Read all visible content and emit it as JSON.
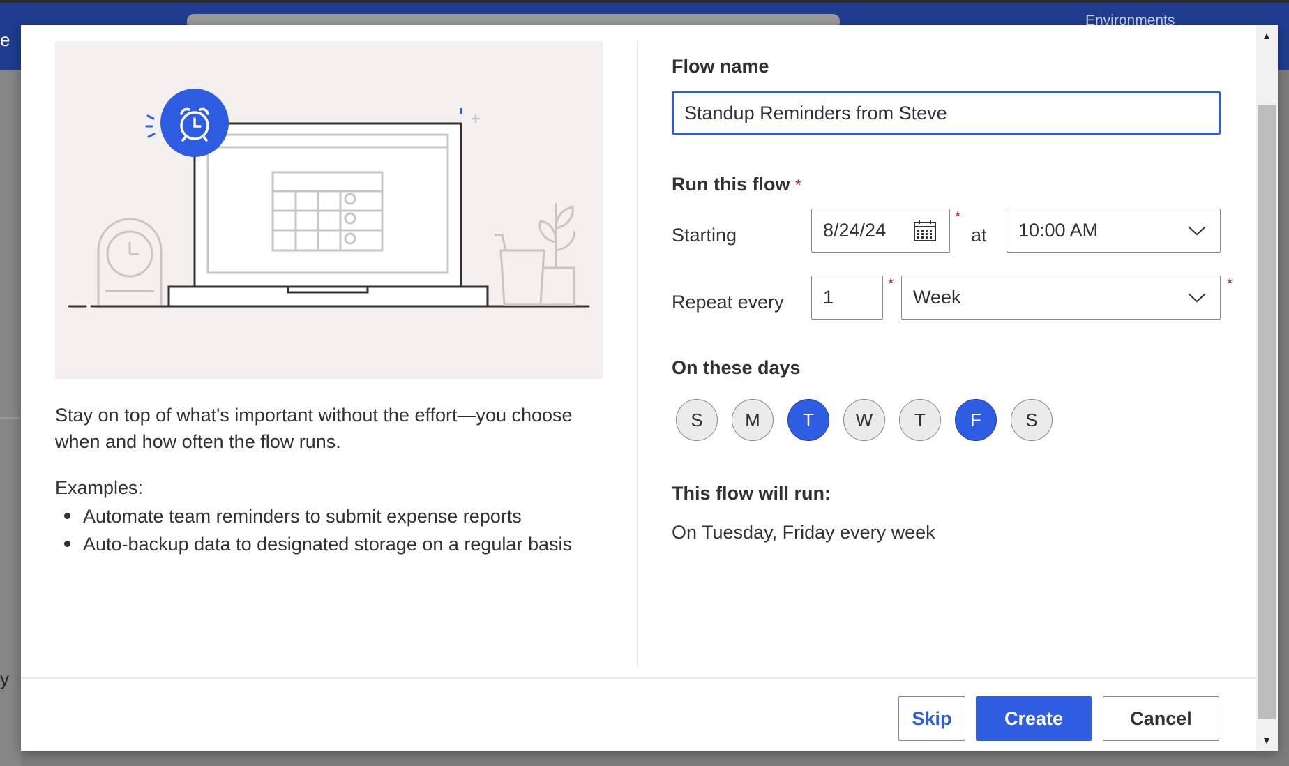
{
  "background": {
    "environments_label": "Environments",
    "left_letter_top": "e",
    "left_letter_bottom": "y"
  },
  "illustration": {
    "icons": [
      "alarm-clock-icon",
      "laptop-icon",
      "calendar-icon",
      "desk-clock-icon",
      "plant-icon"
    ],
    "accent_color": "#2f5de2"
  },
  "description": "Stay on top of what's important without the effort—you choose when and how often the flow runs.",
  "examples": {
    "label": "Examples:",
    "items": [
      "Automate team reminders to submit expense reports",
      "Auto-backup data to designated storage on a regular basis"
    ]
  },
  "form": {
    "flow_name_label": "Flow name",
    "flow_name_value": "Standup Reminders from Steve",
    "run_label": "Run this flow",
    "required_mark": "*",
    "starting_label": "Starting",
    "start_date": "8/24/24",
    "at_label": "at",
    "start_time": "10:00 AM",
    "repeat_label": "Repeat every",
    "repeat_interval": "1",
    "repeat_unit": "Week",
    "days_label": "On these days",
    "days": [
      {
        "letter": "S",
        "selected": false
      },
      {
        "letter": "M",
        "selected": false
      },
      {
        "letter": "T",
        "selected": true
      },
      {
        "letter": "W",
        "selected": false
      },
      {
        "letter": "T",
        "selected": false
      },
      {
        "letter": "F",
        "selected": true
      },
      {
        "letter": "S",
        "selected": false
      }
    ],
    "summary_label": "This flow will run:",
    "summary_value": "On Tuesday, Friday every week"
  },
  "buttons": {
    "skip": "Skip",
    "create": "Create",
    "cancel": "Cancel"
  },
  "colors": {
    "primary": "#2f5de2",
    "required": "#a4262c"
  }
}
